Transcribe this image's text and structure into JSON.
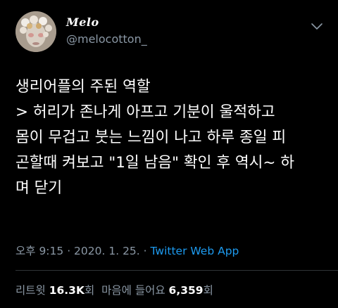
{
  "header": {
    "display_name": "Melo",
    "handle": "@melocotton_",
    "avatar_icon": "profile-avatar",
    "menu_icon": "chevron-down-icon"
  },
  "tweet": {
    "lines": [
      "생리어플의 주된 역할",
      "> 허리가 존나게 아프고 기분이 울적하고",
      "몸이 무겁고 붓는 느낌이 나고 하루 종일 피",
      "곤할때 켜보고 \"1일 남음\" 확인 후 역시~ 하",
      "며 닫기"
    ]
  },
  "meta": {
    "time": "오후 9:15",
    "separator": " · ",
    "date": "2020. 1. 25.",
    "source": "Twitter Web App"
  },
  "stats": {
    "retweets_label": "리트윗",
    "retweets_count": "16.3K",
    "retweets_suffix": "회",
    "likes_label": "마음에 들어요",
    "likes_count": "6,359",
    "likes_suffix": "회"
  },
  "colors": {
    "background": "#000000",
    "text": "#ffffff",
    "secondary": "#8b98a5",
    "link": "#1d9bf0",
    "divider": "#2f3336"
  }
}
